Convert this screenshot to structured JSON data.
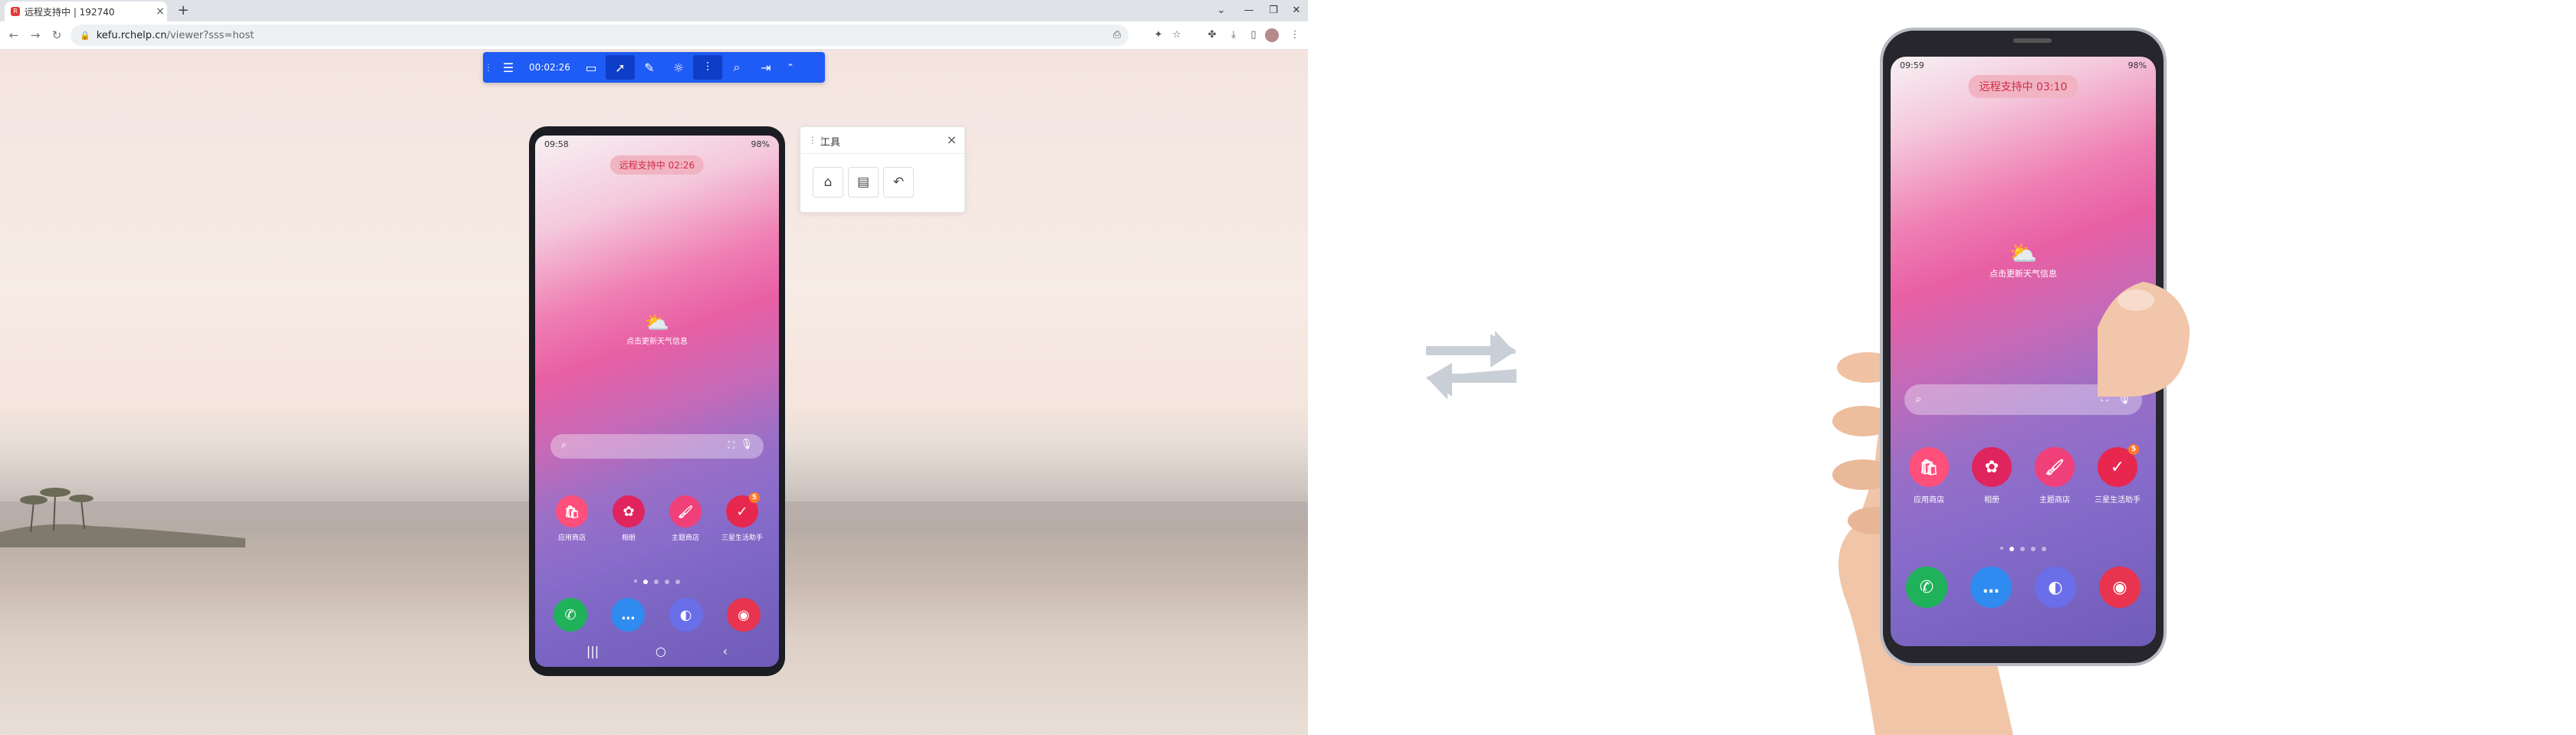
{
  "browser": {
    "tab_title": "远程支持中 | 192740",
    "tab_favicon": "R",
    "url_host": "kefu.rchelp.cn",
    "url_path": "/viewer?sss=host"
  },
  "toolbar": {
    "timer": "00:02:26",
    "items": [
      "menu-icon",
      "video-icon",
      "pointer-icon",
      "pen-icon",
      "brightness-icon",
      "settings-icon",
      "zoom-icon",
      "exit-icon",
      "collapse-icon"
    ]
  },
  "viewer_phone": {
    "status_time": "09:58",
    "status_right": "98%",
    "pill": "远程支持中  02:26",
    "weather_text": "点击更新天气信息",
    "apps_row": [
      {
        "label": "应用商店",
        "color": "#ff4f7b",
        "glyph": "🛍"
      },
      {
        "label": "相册",
        "color": "#e0245e",
        "glyph": "✿"
      },
      {
        "label": "主题商店",
        "color": "#f0407a",
        "glyph": "🖌"
      },
      {
        "label": "三星生活助手",
        "color": "#e8274f",
        "glyph": "✓"
      }
    ],
    "badge": "5",
    "dock": [
      {
        "color": "#1fb25a",
        "glyph": "✆"
      },
      {
        "color": "#2f8bf0",
        "glyph": "···"
      },
      {
        "color": "#6a6ee8",
        "glyph": "◐"
      },
      {
        "color": "#e8344e",
        "glyph": "◉"
      }
    ]
  },
  "tool_panel": {
    "title": "工具",
    "buttons": [
      "home-icon",
      "recent-apps-icon",
      "back-icon"
    ]
  },
  "real_phone": {
    "status_time": "09:59",
    "status_right": "98%",
    "pill": "远程支持中  03:10",
    "weather_text": "点击更新天气信息",
    "apps_row": [
      {
        "label": "应用商店"
      },
      {
        "label": "相册"
      },
      {
        "label": "主题商店"
      },
      {
        "label": "三星生活助手"
      }
    ],
    "badge": "5"
  },
  "colors": {
    "toolbar": "#1f5bf5",
    "pill_text": "#d02a48",
    "swap_arrow": "#c9cfd6"
  }
}
